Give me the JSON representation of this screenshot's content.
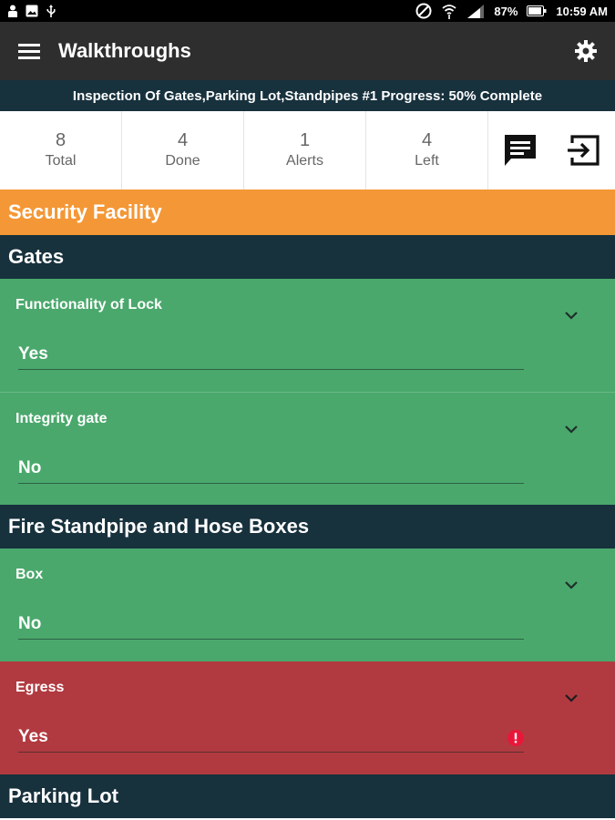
{
  "status_bar": {
    "battery": "87%",
    "time": "10:59 AM",
    "icons": [
      "person-icon",
      "image-icon",
      "usb-icon",
      "block-icon",
      "wifi-icon",
      "signal-icon",
      "battery-icon"
    ]
  },
  "app_bar": {
    "title": "Walkthroughs",
    "menu_icon": "menu-icon",
    "settings_icon": "gear-icon"
  },
  "progress_text": "Inspection Of Gates,Parking Lot,Standpipes #1 Progress: 50% Complete",
  "stats": [
    {
      "value": "8",
      "label": "Total"
    },
    {
      "value": "4",
      "label": "Done"
    },
    {
      "value": "1",
      "label": "Alerts"
    },
    {
      "value": "4",
      "label": "Left"
    }
  ],
  "action_icons": [
    "comment-icon",
    "exit-icon"
  ],
  "facility": "Security Facility",
  "groups": [
    {
      "title": "Gates",
      "items": [
        {
          "question": "Functionality of Lock",
          "answer": "Yes",
          "status": "ok"
        },
        {
          "question": "Integrity gate",
          "answer": "No",
          "status": "ok"
        }
      ]
    },
    {
      "title": "Fire Standpipe and Hose Boxes",
      "items": [
        {
          "question": "Box",
          "answer": "No",
          "status": "ok"
        },
        {
          "question": "Egress",
          "answer": "Yes",
          "status": "alert"
        }
      ]
    },
    {
      "title": "Parking Lot",
      "items": []
    }
  ],
  "colors": {
    "orange": "#f49736",
    "navy": "#17313d",
    "green": "#4aa86c",
    "red": "#b13a40",
    "alert": "#e8173a"
  }
}
